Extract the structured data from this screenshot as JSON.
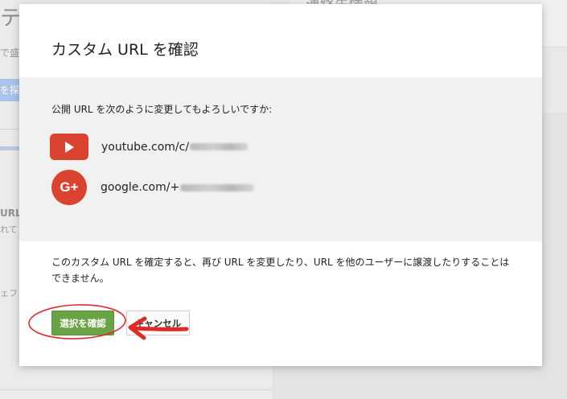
{
  "background": {
    "title_fragment": "テ",
    "small_fragment": "で盛",
    "button_fragment": "を探",
    "url_fragment": "URL",
    "small_fragment2": "れて",
    "small_fragment3": "ェフ",
    "right_heading_fragment": "連絡先情報"
  },
  "dialog": {
    "title": "カスタム URL を確認",
    "question": "公開 URL を次のように変更してもよろしいですか:",
    "youtube": {
      "icon": "youtube-icon",
      "url_prefix": "youtube.com/c/"
    },
    "google_plus": {
      "icon": "google-plus-icon",
      "icon_text": "G+",
      "url_prefix": "google.com/+"
    },
    "notice": "このカスタム URL を確定すると、再び URL を変更したり、URL を他のユーザーに譲渡したりすることはできません。",
    "confirm_label": "選択を確認",
    "cancel_label": "キャンセル"
  },
  "colors": {
    "brand_red": "#d9432f",
    "confirm_green": "#6aa345",
    "annotation_red": "#e02a2a"
  }
}
